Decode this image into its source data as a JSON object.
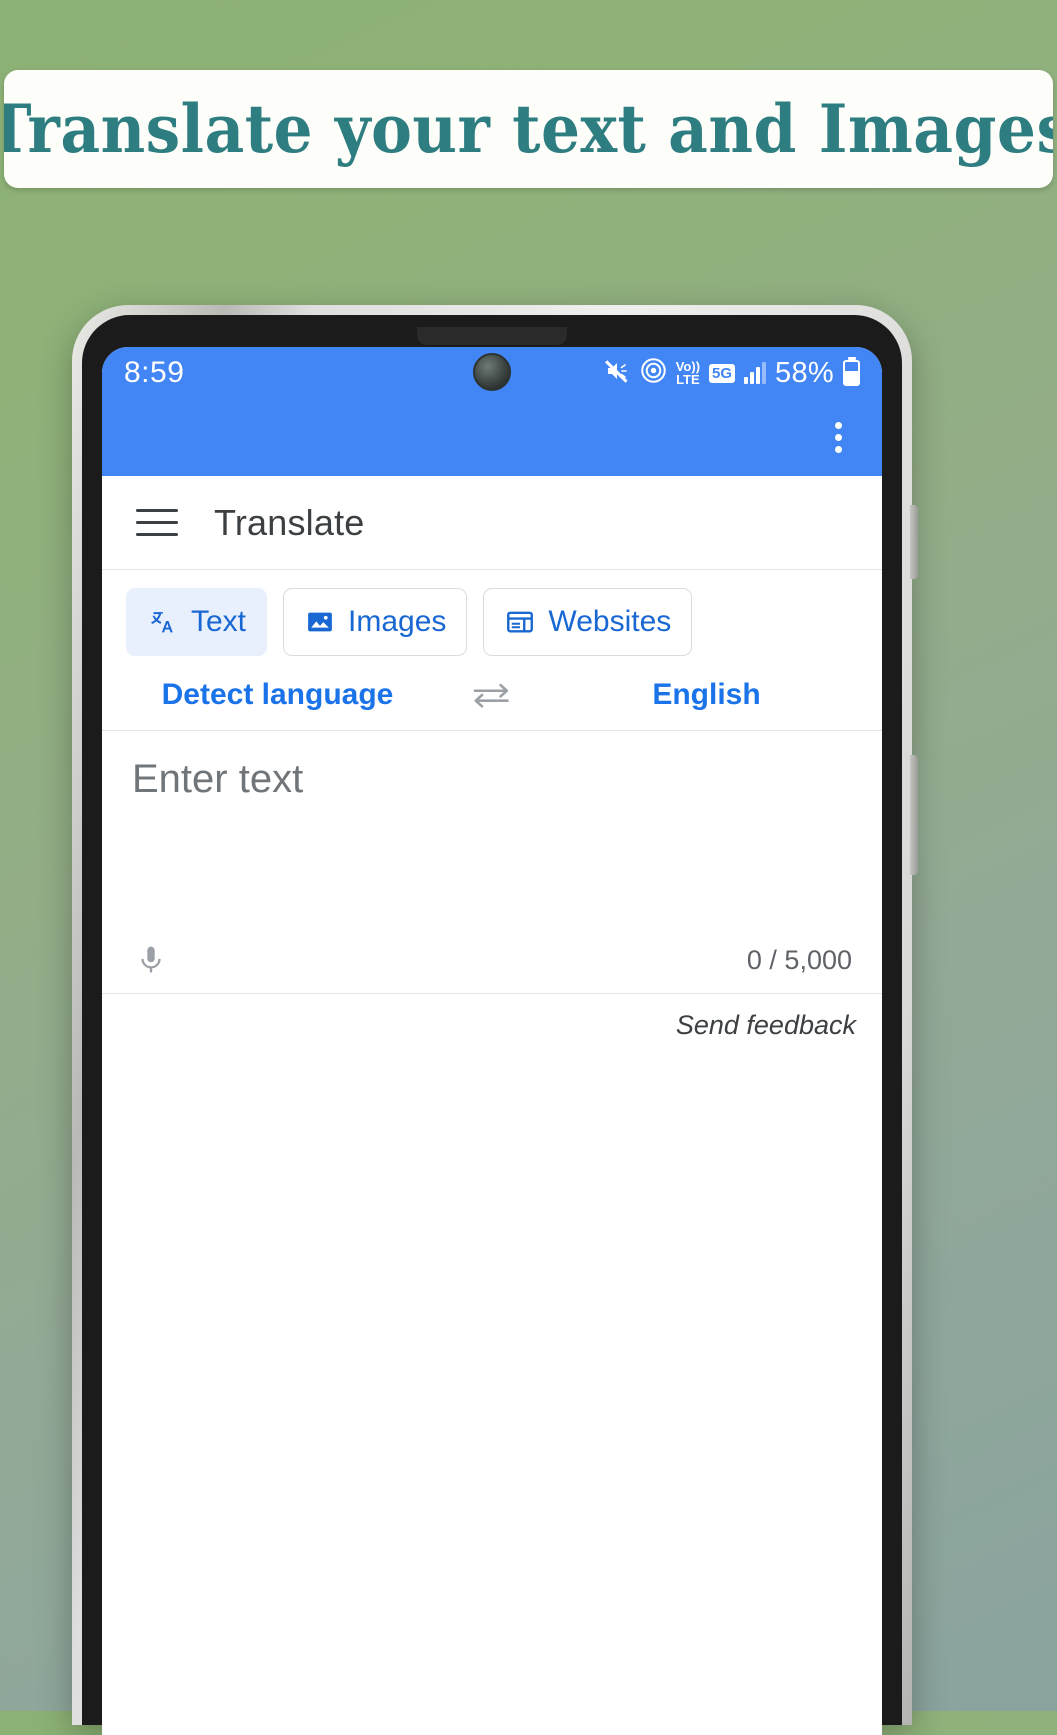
{
  "banner": {
    "text": "Translate your text and Images",
    "text_color": "#2e7d80",
    "background": "#fdfdfa"
  },
  "background": {
    "gradient_from": "#8cb174",
    "gradient_to": "#8aa39e"
  },
  "phone": {
    "status_bar": {
      "time": "8:59",
      "background": "#4285f4",
      "icons": [
        "mute-icon",
        "hotspot-icon",
        "volte-icon",
        "5g-icon",
        "signal-bars-icon",
        "battery-icon"
      ],
      "volte_top": "Vo))",
      "volte_bottom": "LTE",
      "network": "5G",
      "battery_percent": "58%"
    },
    "app_bar": {
      "background": "#4285f4",
      "overflow_menu": "more-options"
    },
    "toolbar": {
      "menu_icon": "hamburger-menu",
      "title": "Translate"
    },
    "tabs": [
      {
        "label": "Text",
        "icon": "translate-icon",
        "active": true
      },
      {
        "label": "Images",
        "icon": "image-icon",
        "active": false
      },
      {
        "label": "Websites",
        "icon": "website-icon",
        "active": false
      }
    ],
    "languages": {
      "source": "Detect language",
      "swap_icon": "swap-arrows-icon",
      "target": "English",
      "link_color": "#1a73e8"
    },
    "input": {
      "placeholder": "Enter text",
      "value": "",
      "mic_icon": "microphone-icon",
      "counter": "0 / 5,000"
    },
    "feedback": {
      "label": "Send feedback"
    }
  }
}
